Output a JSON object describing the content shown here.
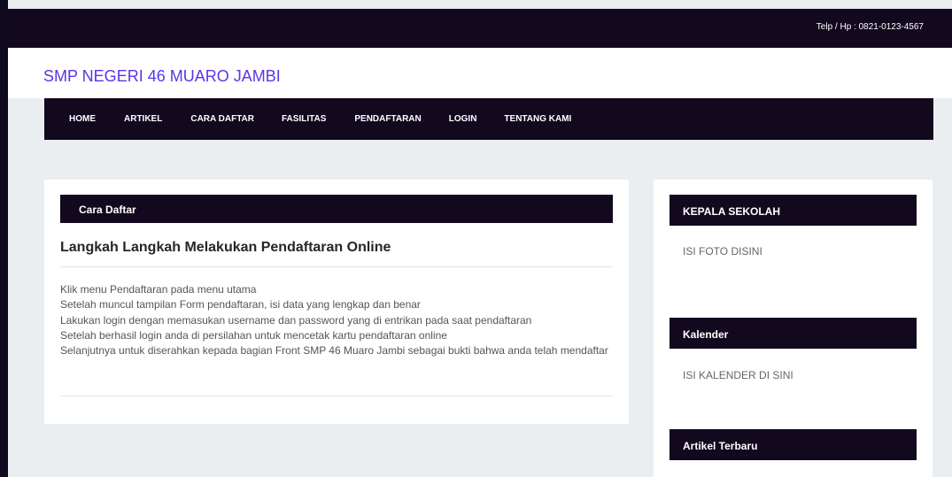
{
  "topbar": {
    "phone": "Telp / Hp : 0821-0123-4567"
  },
  "header": {
    "site_title": "SMP NEGERI 46 MUARO JAMBI"
  },
  "nav": {
    "items": [
      {
        "label": "HOME"
      },
      {
        "label": "ARTIKEL"
      },
      {
        "label": "CARA DAFTAR"
      },
      {
        "label": "FASILITAS"
      },
      {
        "label": "PENDAFTARAN"
      },
      {
        "label": "LOGIN"
      },
      {
        "label": "TENTANG KAMI"
      }
    ]
  },
  "main": {
    "section_title": "Cara Daftar",
    "article_title": "Langkah Langkah Melakukan Pendaftaran Online",
    "steps": [
      "Klik menu Pendaftaran pada menu utama",
      "Setelah muncul tampilan Form pendaftaran, isi data yang lengkap dan benar",
      "Lakukan login dengan memasukan username dan password yang di entrikan pada saat pendaftaran",
      "Setelah berhasil login anda di persilahan untuk mencetak kartu pendaftaran online",
      "Selanjutnya untuk diserahkan kepada bagian Front SMP 46 Muaro Jambi sebagai bukti bahwa anda telah mendaftar"
    ]
  },
  "sidebar": {
    "kepala_title": "KEPALA SEKOLAH",
    "kepala_text": "ISI FOTO DISINI",
    "kalender_title": "Kalender",
    "kalender_text": "ISI KALENDER DI SINI",
    "artikel_title": "Artikel Terbaru"
  },
  "colors": {
    "dark": "#12091f",
    "accent": "#5b35e6",
    "background": "#ebeef1"
  }
}
